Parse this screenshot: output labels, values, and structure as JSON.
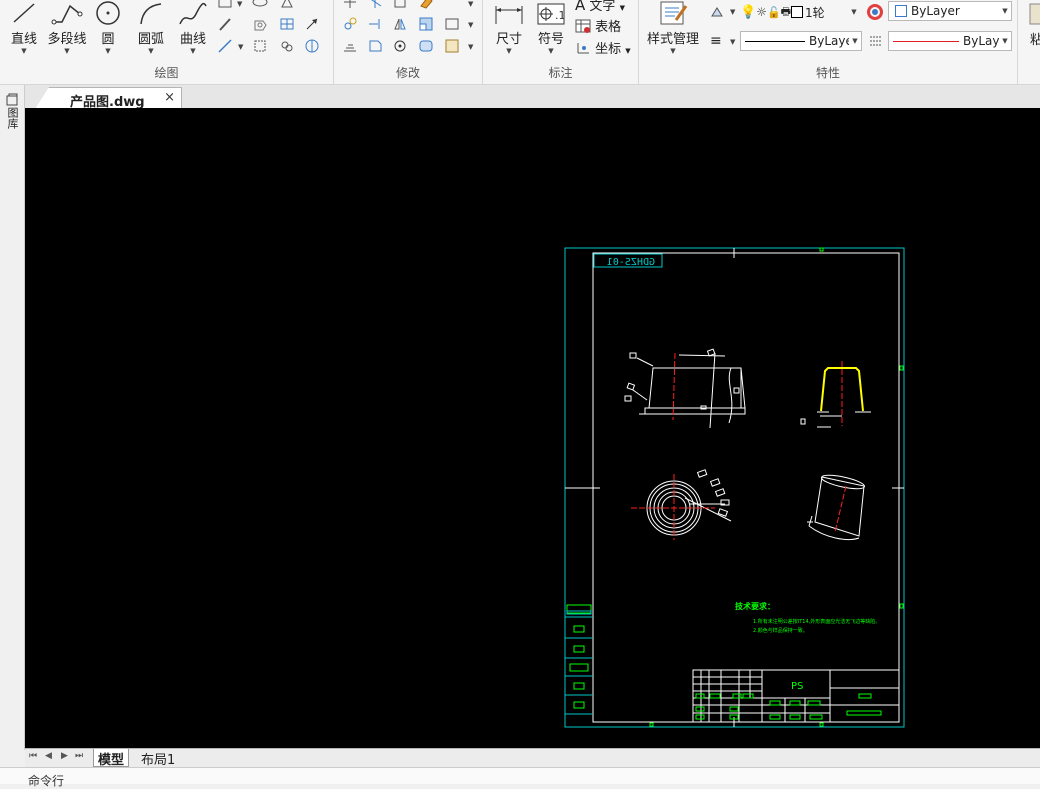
{
  "ribbon": {
    "draw": {
      "title": "绘图",
      "line": "直线",
      "polyline": "多段线",
      "circle": "圆",
      "arc": "圆弧",
      "spline": "曲线"
    },
    "modify": {
      "title": "修改"
    },
    "annotate": {
      "title": "标注",
      "dimension": "尺寸",
      "symbol": "符号",
      "text": "文字",
      "table": "表格",
      "coordinate": "坐标"
    },
    "properties": {
      "title": "特性",
      "style_manager": "样式管理",
      "layer_value": "1轮",
      "color_value": "ByLayer",
      "linetype_value": "ByLayer",
      "lineweight_value": "ByLayer"
    },
    "next_group_first_char": "粘"
  },
  "side_panel": {
    "label": "图库"
  },
  "doc_tab": {
    "title": "产品图.dwg",
    "close": "×"
  },
  "drawing": {
    "drawing_number": "GDHZS-01",
    "material": "PS",
    "tech_title": "技术要求：",
    "tech_line1": "1.所有未注明公差按IT14,外形表面应光洁无飞边等缺陷。",
    "tech_line2": "2.颜色与样品保持一致。"
  },
  "layout_tabs": {
    "model": "模型",
    "layout1": "布局1"
  },
  "command_line": {
    "label": "命令行"
  },
  "colors": {
    "canvas_bg": "#000000",
    "frame": "#00c8c8",
    "geometry": "#ffffff",
    "centerline": "#ff2020",
    "annotation": "#00ff00",
    "highlight": "#ffff00"
  }
}
